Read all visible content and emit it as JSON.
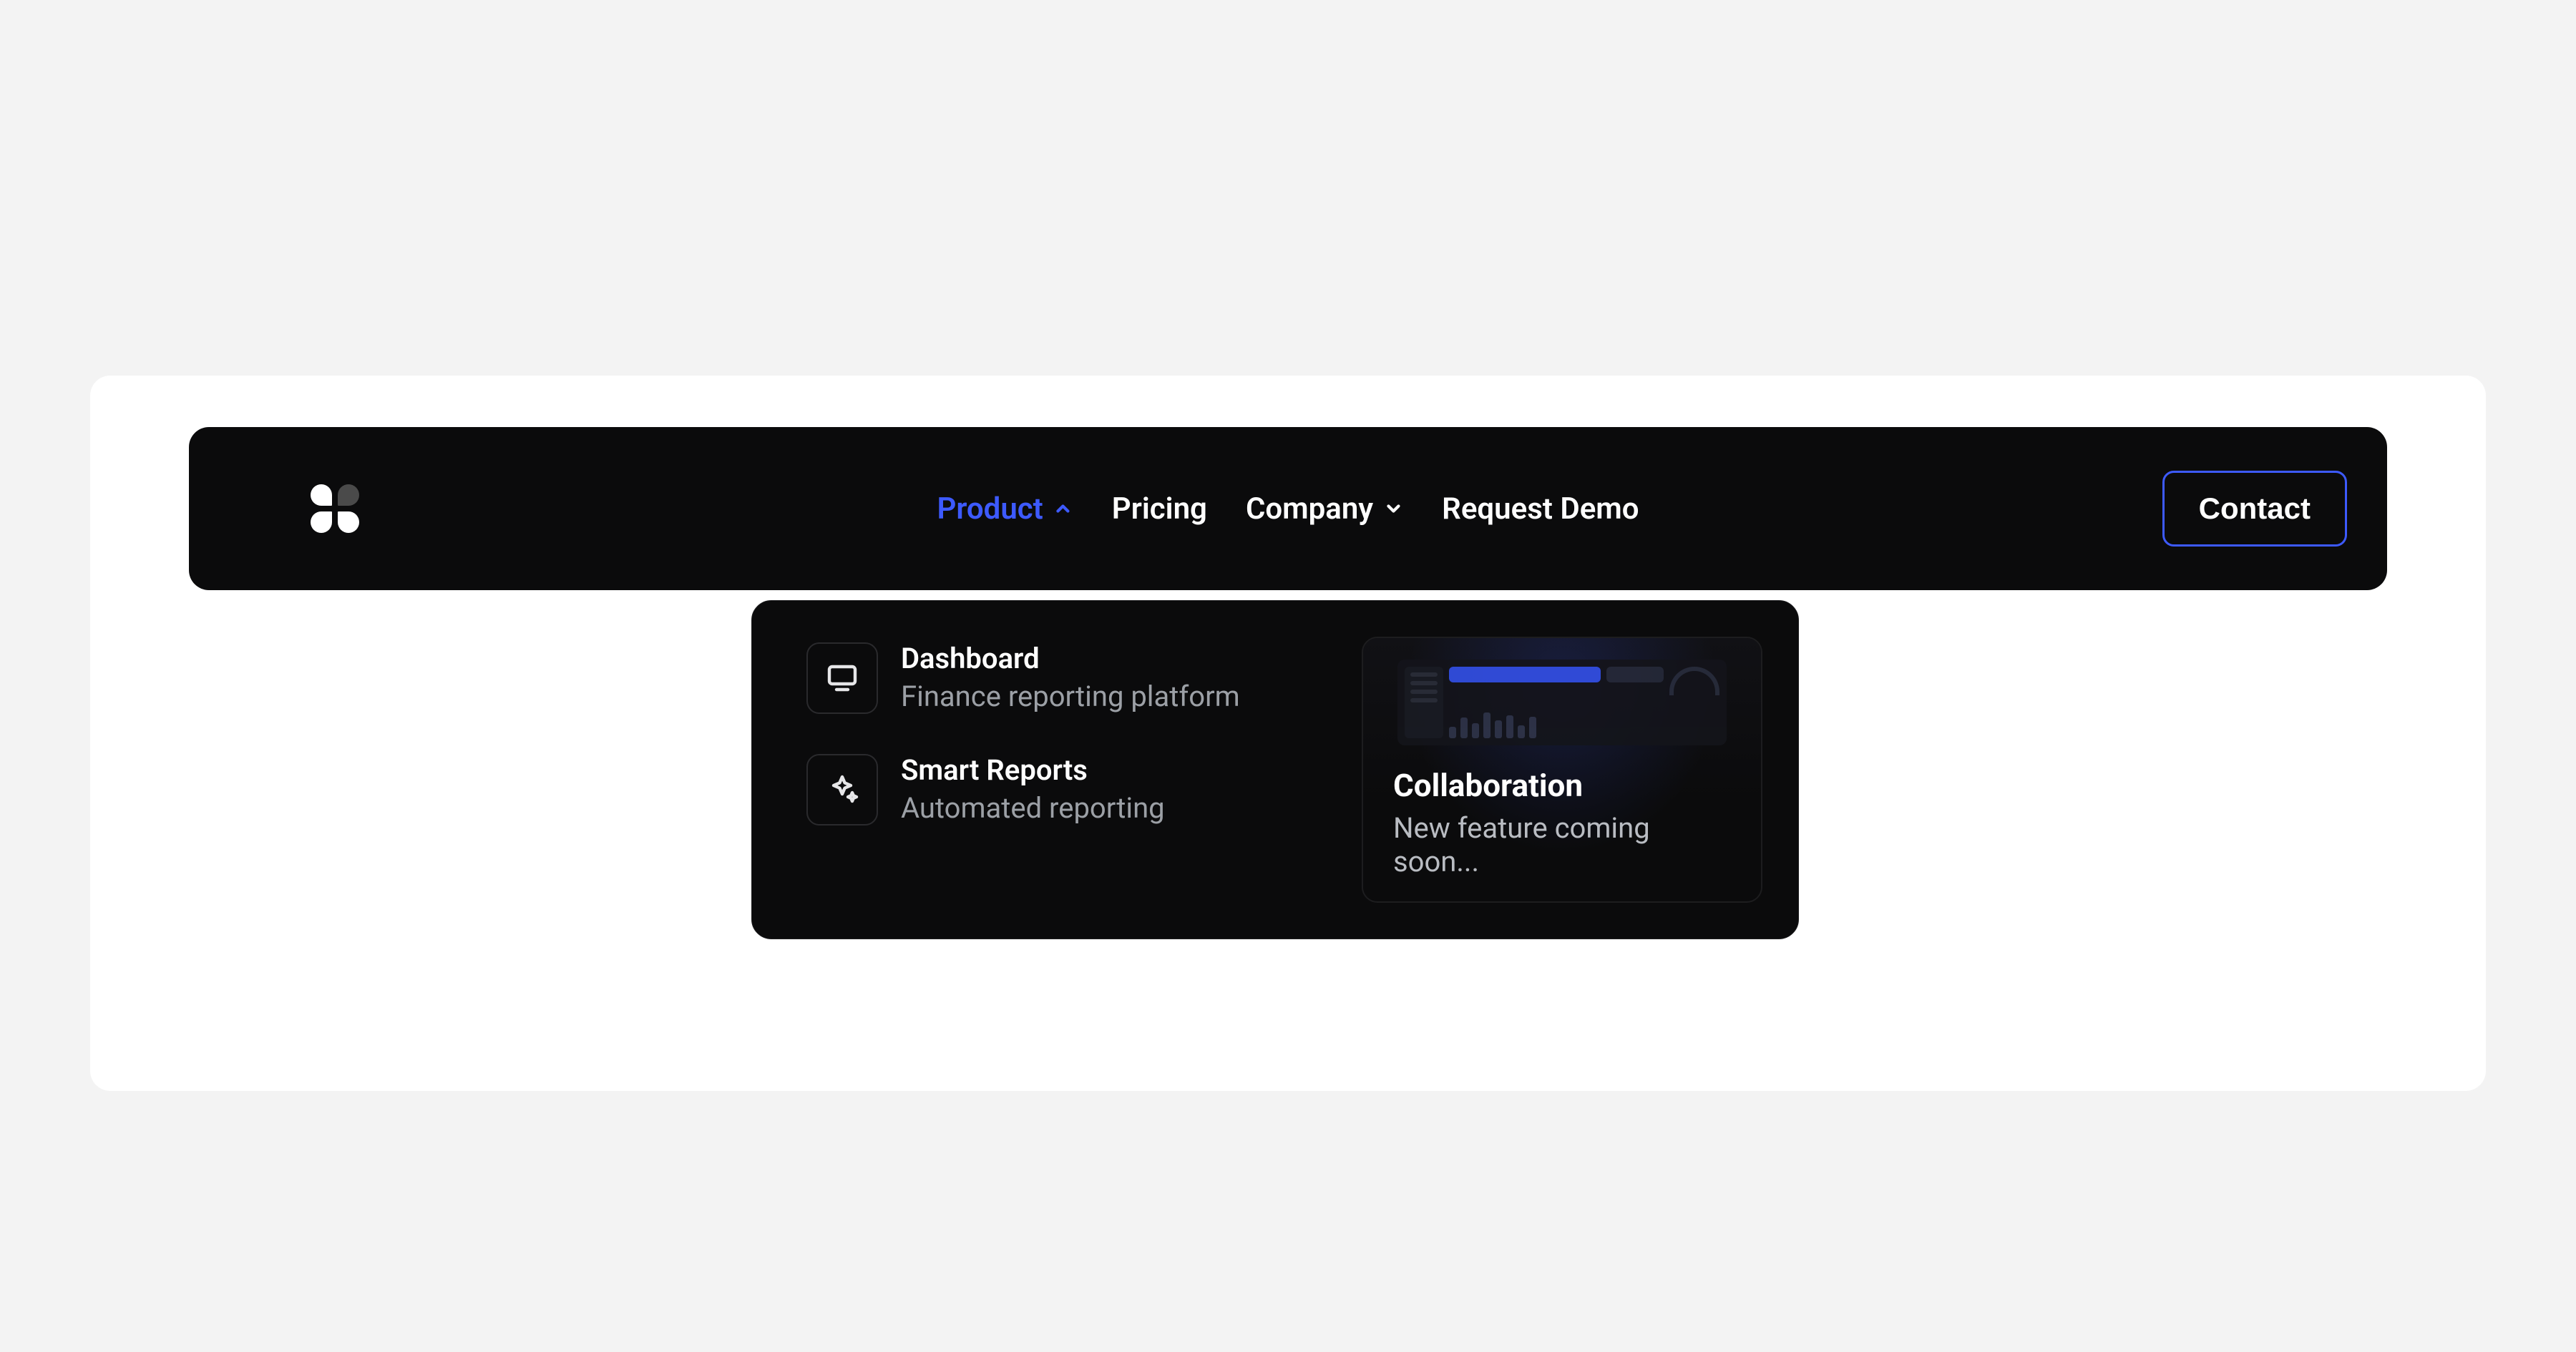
{
  "nav": {
    "items": [
      {
        "label": "Product",
        "has_chevron": true,
        "active": true
      },
      {
        "label": "Pricing",
        "has_chevron": false,
        "active": false
      },
      {
        "label": "Company",
        "has_chevron": true,
        "active": false
      },
      {
        "label": "Request Demo",
        "has_chevron": false,
        "active": false
      }
    ],
    "contact_label": "Contact"
  },
  "dropdown": {
    "items": [
      {
        "icon": "monitor-icon",
        "title": "Dashboard",
        "subtitle": "Finance reporting platform"
      },
      {
        "icon": "sparkles-icon",
        "title": "Smart Reports",
        "subtitle": "Automated reporting"
      }
    ],
    "card": {
      "title": "Collaboration",
      "subtitle": "New feature coming soon..."
    }
  },
  "colors": {
    "accent": "#3d5afe",
    "surface_dark": "#0b0b0c"
  }
}
